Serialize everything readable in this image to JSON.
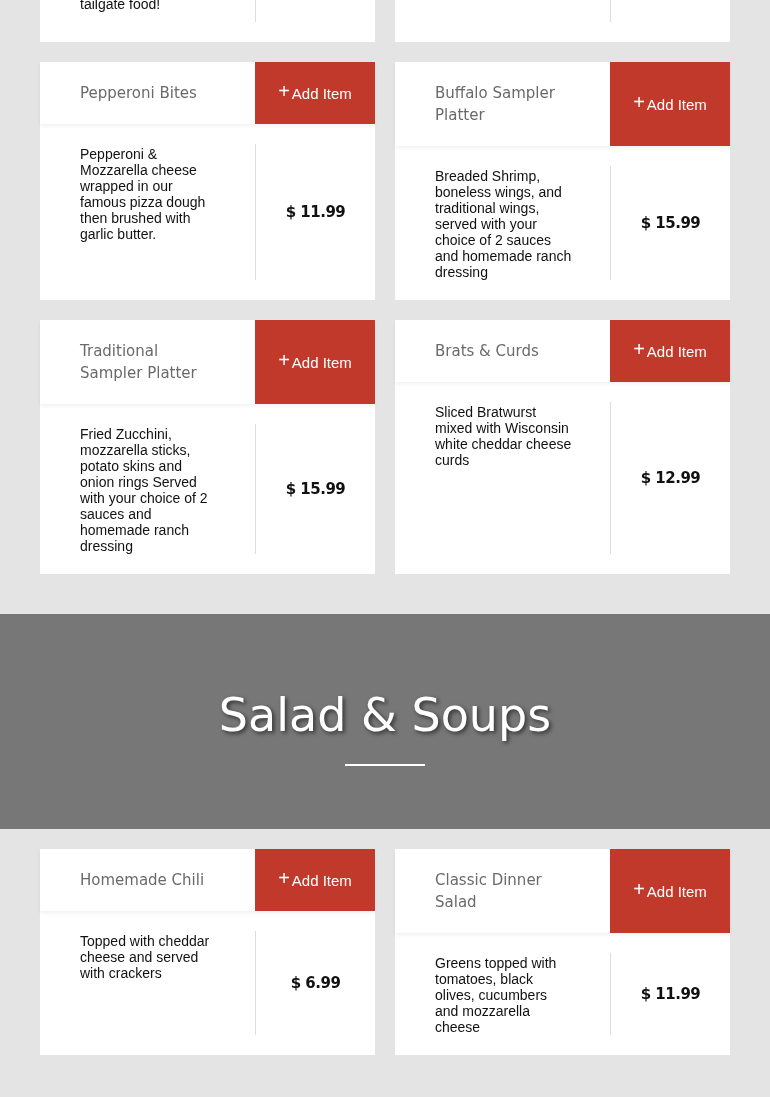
{
  "partial_item": {
    "description": "tailgate food!"
  },
  "appetizers": [
    {
      "name": "Pepperoni Bites",
      "button_icon": "+",
      "button_label": "Add Item",
      "description": "Pepperoni & Mozzarella cheese wrapped in our famous pizza dough then brushed with garlic butter.",
      "price": "$ 11.99"
    },
    {
      "name": "Buffalo Sampler Platter",
      "button_icon": "+",
      "button_label": "Add Item",
      "description": "Breaded Shrimp, boneless wings, and traditional wings, served with your choice of 2 sauces and homemade ranch dressing",
      "price": "$ 15.99"
    },
    {
      "name": "Traditional Sampler Platter",
      "button_icon": "+",
      "button_label": "Add Item",
      "description": "Fried Zucchini, mozzarella sticks, potato skins and onion rings Served with your choice of 2 sauces and homemade ranch dressing",
      "price": "$ 15.99"
    },
    {
      "name": "Brats & Curds",
      "button_icon": "+",
      "button_label": "Add Item",
      "description": "Sliced Bratwurst mixed with Wisconsin white cheddar cheese curds",
      "price": "$ 12.99"
    }
  ],
  "section_banner": {
    "title": "Salad & Soups"
  },
  "salads": [
    {
      "name": "Homemade Chili",
      "button_icon": "+",
      "button_label": "Add Item",
      "description": "Topped with cheddar cheese and served with crackers",
      "price": "$ 6.99"
    },
    {
      "name": "Classic Dinner Salad",
      "button_icon": "+",
      "button_label": "Add Item",
      "description": "Greens topped with tomatoes, black olives, cucumbers and mozzarella cheese",
      "price": "$ 11.99"
    }
  ]
}
